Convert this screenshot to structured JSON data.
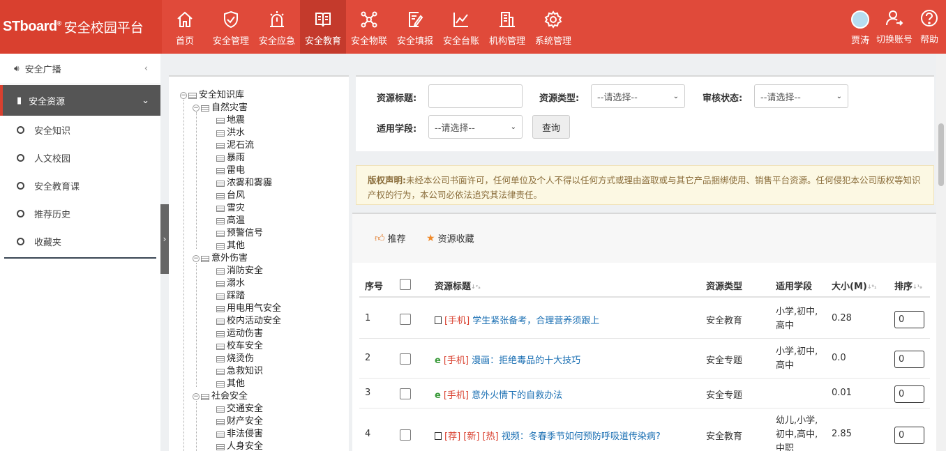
{
  "brand": {
    "logo": "STboard",
    "title": "安全校园平台"
  },
  "nav": [
    {
      "label": "首页",
      "icon": "home-icon"
    },
    {
      "label": "安全管理",
      "icon": "shield-check-icon"
    },
    {
      "label": "安全应急",
      "icon": "alarm-icon"
    },
    {
      "label": "安全教育",
      "icon": "book-icon"
    },
    {
      "label": "安全物联",
      "icon": "network-icon"
    },
    {
      "label": "安全填报",
      "icon": "edit-form-icon"
    },
    {
      "label": "安全台账",
      "icon": "chart-line-icon"
    },
    {
      "label": "机构管理",
      "icon": "building-icon"
    },
    {
      "label": "系统管理",
      "icon": "gear-icon"
    }
  ],
  "user": {
    "name": "贾涛",
    "switch": "切换账号",
    "help": "帮助"
  },
  "sidebar": {
    "broadcast": "安全广播",
    "group": "安全资源",
    "items": [
      "安全知识",
      "人文校园",
      "安全教育课",
      "推荐历史",
      "收藏夹"
    ]
  },
  "tree": {
    "root": "安全知识库",
    "groups": [
      {
        "label": "自然灾害",
        "children": [
          "地震",
          "洪水",
          "泥石流",
          "暴雨",
          "雷电",
          "浓雾和雾霾",
          "台风",
          "雪灾",
          "高温",
          "预警信号",
          "其他"
        ]
      },
      {
        "label": "意外伤害",
        "children": [
          "消防安全",
          "溺水",
          "踩踏",
          "用电用气安全",
          "校内活动安全",
          "运动伤害",
          "校车安全",
          "烧烫伤",
          "急救知识",
          "其他"
        ]
      },
      {
        "label": "社会安全",
        "children": [
          "交通安全",
          "财产安全",
          "非法侵害",
          "人身安全"
        ]
      }
    ]
  },
  "search": {
    "title_label": "资源标题:",
    "type_label": "资源类型:",
    "type_value": "--请选择--",
    "audit_label": "审核状态:",
    "audit_value": "--请选择--",
    "stage_label": "适用学段:",
    "stage_value": "--请选择--",
    "query_btn": "查询"
  },
  "notice": {
    "head": "版权声明:",
    "text": "未经本公司书面许可，任何单位及个人不得以任何方式或理由盗取或与其它产品捆绑使用、销售平台资源。任何侵犯本公司版权等知识产权的行为，本公司必依法追究其法律责任。"
  },
  "toolbar": {
    "recommend": "推荐",
    "favorite": "资源收藏"
  },
  "table": {
    "headers": [
      "序号",
      "资源标题",
      "资源类型",
      "适用学段",
      "大小(M)",
      "排序"
    ],
    "rows": [
      {
        "no": "1",
        "tags": "[手机]",
        "title": "学生紧张备考，合理营养须跟上",
        "type": "安全教育",
        "stage": "小学,初中,高中",
        "size": "0.28",
        "order": "0",
        "icon": "image"
      },
      {
        "no": "2",
        "tags": "[手机]",
        "title": "漫画：拒绝毒品的十大技巧",
        "type": "安全专题",
        "stage": "小学,初中,高中",
        "size": "0.0",
        "order": "0",
        "icon": "web"
      },
      {
        "no": "3",
        "tags": "[手机]",
        "title": "意外火情下的自救办法",
        "type": "安全专题",
        "stage": "",
        "size": "0.01",
        "order": "0",
        "icon": "web"
      },
      {
        "no": "4",
        "tags": "[荐] [新] [热]",
        "title": "视频：冬春季节如何预防呼吸道传染病?",
        "type": "安全教育",
        "stage": "幼儿,小学,初中,高中,中职",
        "size": "2.85",
        "order": "0",
        "icon": "video"
      }
    ]
  }
}
